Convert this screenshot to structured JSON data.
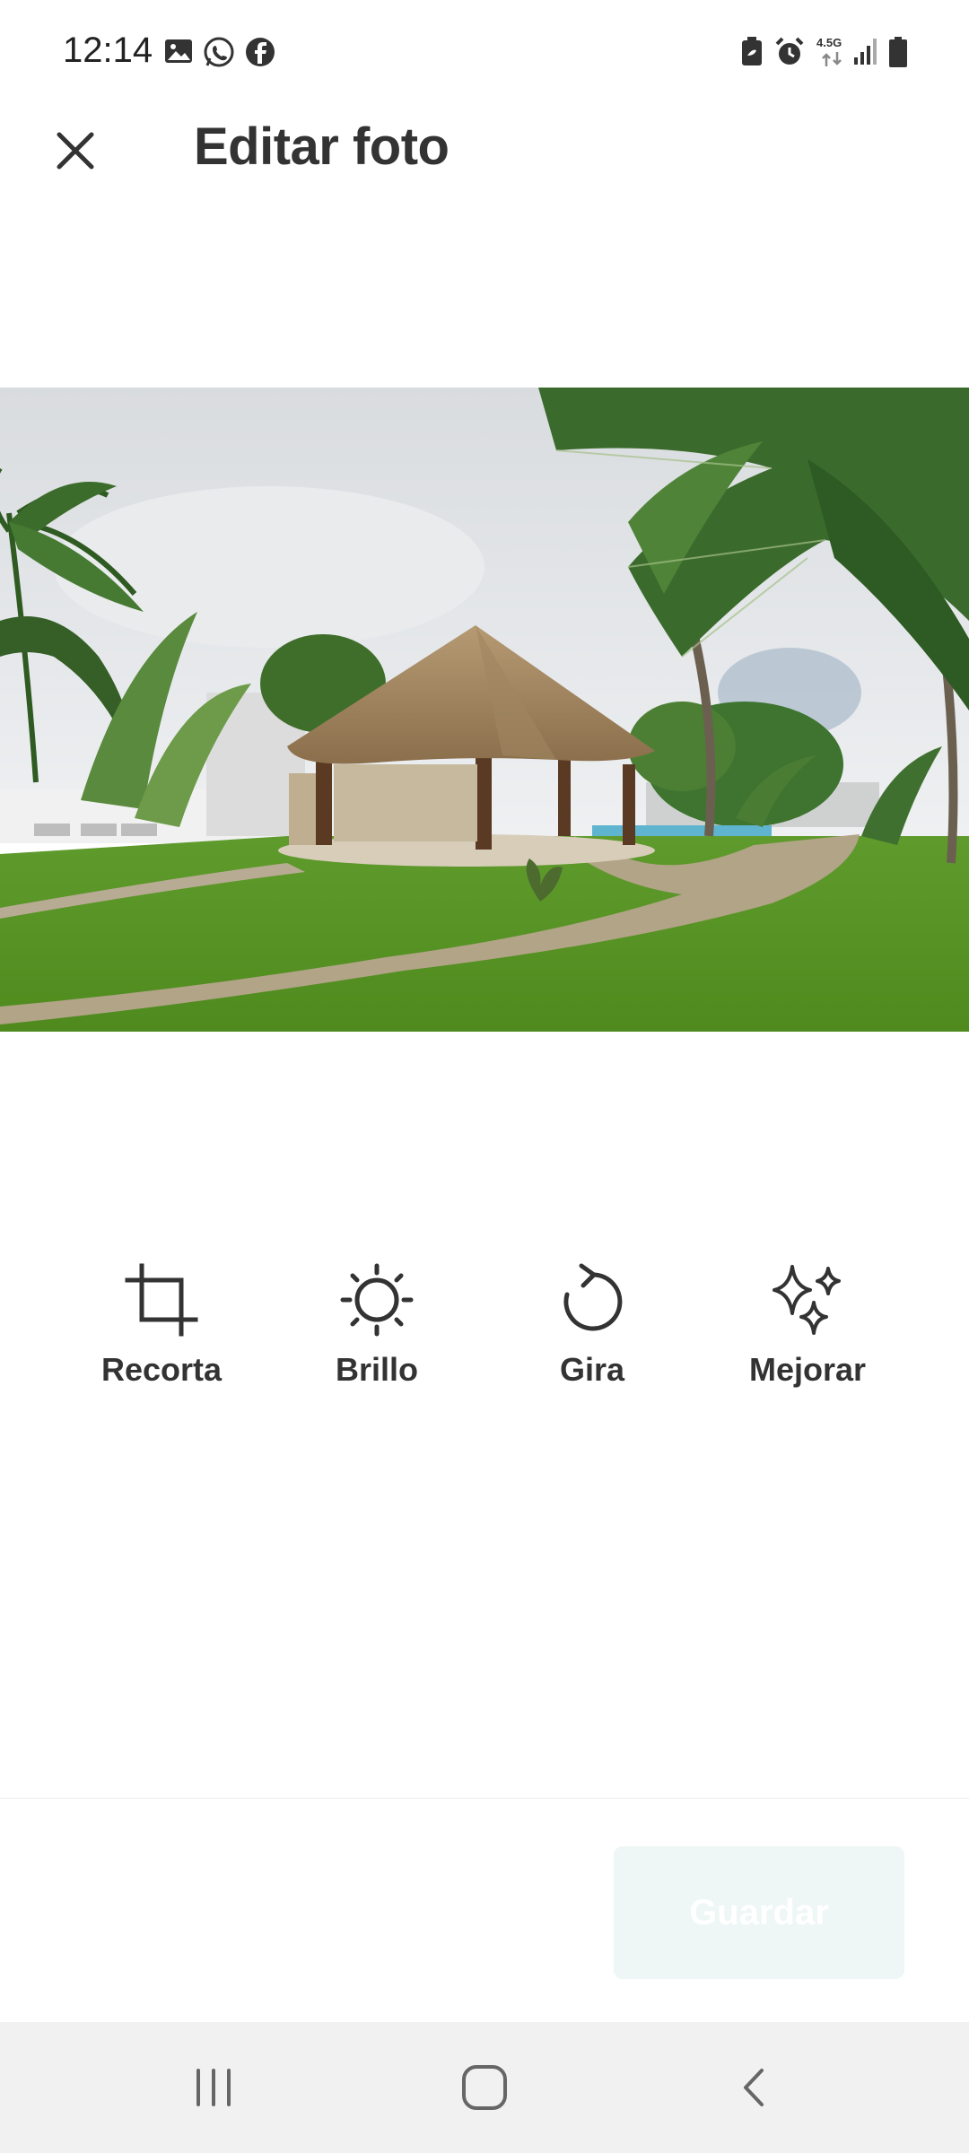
{
  "status_bar": {
    "time": "12:14",
    "network": "4.5G",
    "left_icons": [
      "gallery-icon",
      "whatsapp-icon",
      "facebook-icon"
    ],
    "right_icons": [
      "battery-saver-icon",
      "alarm-icon",
      "network-4-5g-icon",
      "signal-icon",
      "battery-icon"
    ]
  },
  "header": {
    "title": "Editar foto",
    "close_icon": "close-icon"
  },
  "photo": {
    "alt": "Palapa con techo de paja, jardín y palmeras"
  },
  "tools": [
    {
      "label": "Recorta",
      "icon": "crop-icon"
    },
    {
      "label": "Brillo",
      "icon": "brightness-icon"
    },
    {
      "label": "Gira",
      "icon": "rotate-icon"
    },
    {
      "label": "Mejorar",
      "icon": "sparkle-icon"
    }
  ],
  "actions": {
    "save_label": "Guardar",
    "save_enabled": false
  },
  "nav": {
    "icons": [
      "recent-apps-icon",
      "home-icon",
      "back-icon"
    ]
  },
  "colors": {
    "text": "#333333",
    "save_button_bg": "#eef7f5",
    "nav_bg": "#f1f1f1"
  }
}
